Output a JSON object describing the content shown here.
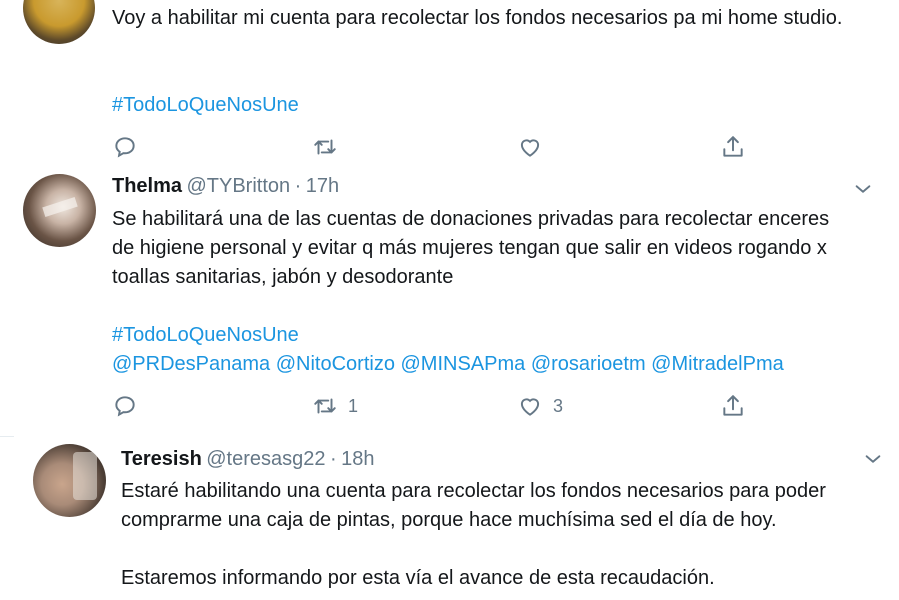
{
  "tweets": [
    {
      "text": "Voy a habilitar mi cuenta para recolectar los fondos necesarios pa mi home studio.",
      "hashtag": "#TodoLoQueNosUne"
    },
    {
      "name": "Thelma",
      "handle": "@TYBritton",
      "time": "17h",
      "text": "Se habilitará una de las cuentas de donaciones privadas para recolectar enceres de higiene personal y evitar q más mujeres tengan que salir en videos rogando x toallas sanitarias, jabón y desodorante",
      "hashtag": "#TodoLoQueNosUne",
      "mentions": [
        "@PRDesPanama",
        "@NitoCortizo",
        "@MINSAPma",
        "@rosarioetm",
        "@MitradelPma"
      ],
      "retweets": "1",
      "likes": "3"
    },
    {
      "name": "Teresish",
      "handle": "@teresasg22",
      "time": "18h",
      "text_line1": "Estaré habilitando una cuenta para recolectar los fondos necesarios para poder comprarme una caja de pintas, porque hace muchísima sed el día de hoy.",
      "text_line2": "Estaremos informando por esta vía el avance de esta recaudación."
    }
  ],
  "separator": "·",
  "icons": [
    "reply-icon",
    "retweet-icon",
    "like-icon",
    "share-icon",
    "chevron-down-icon"
  ],
  "colors": {
    "link": "#1b95e0",
    "muted": "#657786",
    "text": "#14171a"
  }
}
